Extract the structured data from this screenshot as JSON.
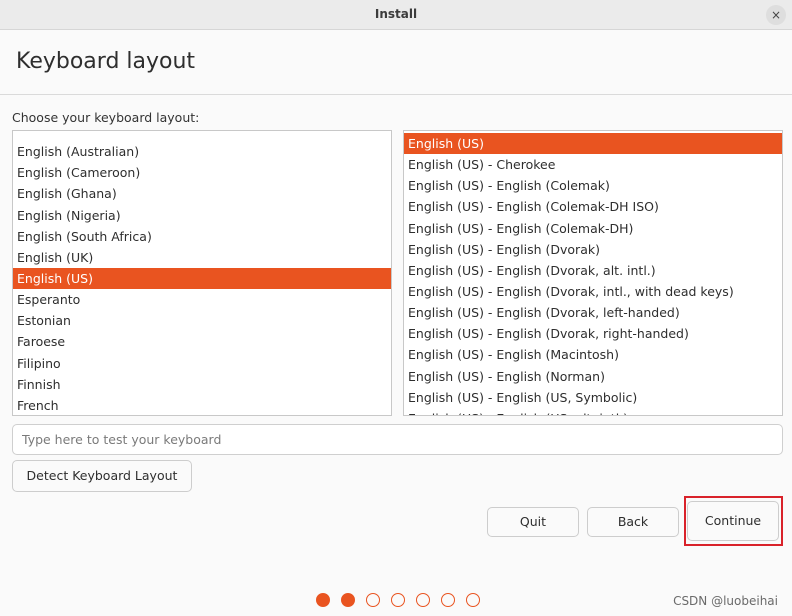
{
  "window": {
    "title": "Install",
    "close_glyph": "×"
  },
  "page": {
    "title": "Keyboard layout",
    "prompt": "Choose your keyboard layout:"
  },
  "layouts": [
    {
      "label": "English (Australian)",
      "selected": false
    },
    {
      "label": "English (Cameroon)",
      "selected": false
    },
    {
      "label": "English (Ghana)",
      "selected": false
    },
    {
      "label": "English (Nigeria)",
      "selected": false
    },
    {
      "label": "English (South Africa)",
      "selected": false
    },
    {
      "label": "English (UK)",
      "selected": false
    },
    {
      "label": "English (US)",
      "selected": true
    },
    {
      "label": "Esperanto",
      "selected": false
    },
    {
      "label": "Estonian",
      "selected": false
    },
    {
      "label": "Faroese",
      "selected": false
    },
    {
      "label": "Filipino",
      "selected": false
    },
    {
      "label": "Finnish",
      "selected": false
    },
    {
      "label": "French",
      "selected": false
    }
  ],
  "variants": [
    {
      "label": "English (US)",
      "selected": true
    },
    {
      "label": "English (US) - Cherokee",
      "selected": false
    },
    {
      "label": "English (US) - English (Colemak)",
      "selected": false
    },
    {
      "label": "English (US) - English (Colemak-DH ISO)",
      "selected": false
    },
    {
      "label": "English (US) - English (Colemak-DH)",
      "selected": false
    },
    {
      "label": "English (US) - English (Dvorak)",
      "selected": false
    },
    {
      "label": "English (US) - English (Dvorak, alt. intl.)",
      "selected": false
    },
    {
      "label": "English (US) - English (Dvorak, intl., with dead keys)",
      "selected": false
    },
    {
      "label": "English (US) - English (Dvorak, left-handed)",
      "selected": false
    },
    {
      "label": "English (US) - English (Dvorak, right-handed)",
      "selected": false
    },
    {
      "label": "English (US) - English (Macintosh)",
      "selected": false
    },
    {
      "label": "English (US) - English (Norman)",
      "selected": false
    },
    {
      "label": "English (US) - English (US, Symbolic)",
      "selected": false
    },
    {
      "label": "English (US) - English (US, alt. intl.)",
      "selected": false
    }
  ],
  "test_input": {
    "value": "",
    "placeholder": "Type here to test your keyboard"
  },
  "buttons": {
    "detect": "Detect Keyboard Layout",
    "quit": "Quit",
    "back": "Back",
    "continue": "Continue"
  },
  "progress": {
    "total_steps": 7,
    "completed_steps": 2
  },
  "watermark": "CSDN @luobeihai",
  "colors": {
    "accent": "#e95420",
    "highlight_box": "#d9222a"
  }
}
